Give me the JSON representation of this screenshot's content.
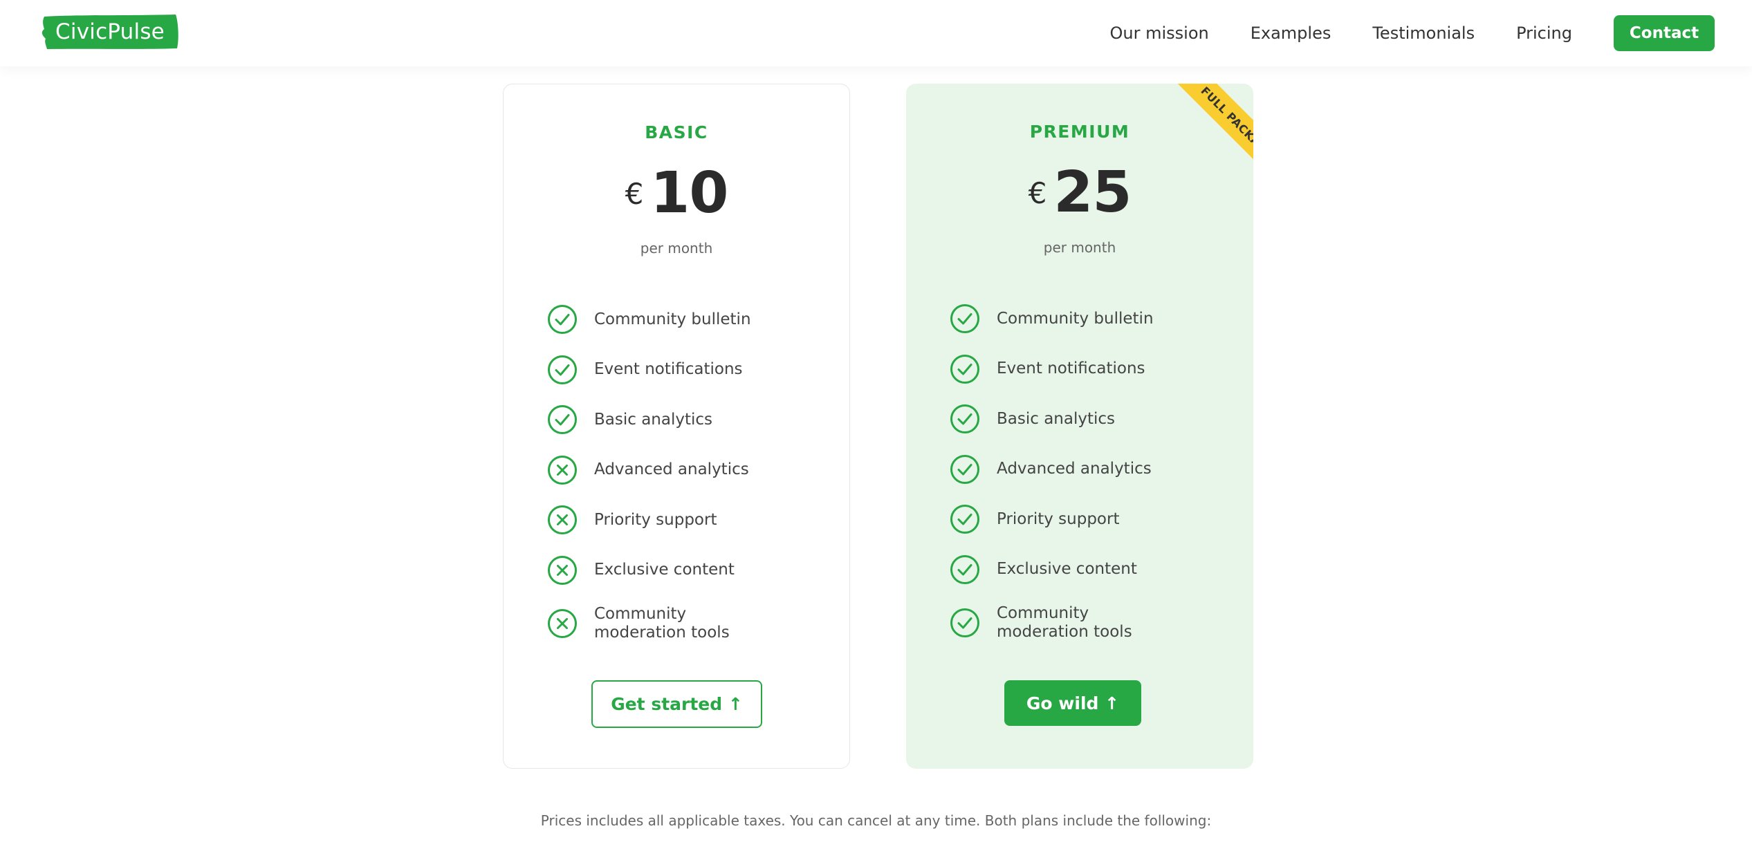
{
  "colors": {
    "accent": "#28a745",
    "ribbon": "#f9cc2f",
    "premium_bg": "#e8f5e9"
  },
  "header": {
    "logo_text": "CivicPulse",
    "nav": [
      {
        "label": "Our mission"
      },
      {
        "label": "Examples"
      },
      {
        "label": "Testimonials"
      },
      {
        "label": "Pricing"
      }
    ],
    "contact_label": "Contact"
  },
  "plans": [
    {
      "name": "BASIC",
      "currency": "€",
      "amount": "10",
      "period": "per month",
      "features": [
        {
          "label": "Community bulletin",
          "included": true
        },
        {
          "label": "Event notifications",
          "included": true
        },
        {
          "label": "Basic analytics",
          "included": true
        },
        {
          "label": "Advanced analytics",
          "included": false
        },
        {
          "label": "Priority support",
          "included": false
        },
        {
          "label": "Exclusive content",
          "included": false
        },
        {
          "label": "Community moderation tools",
          "included": false
        }
      ],
      "cta": "Get started ↑"
    },
    {
      "name": "PREMIUM",
      "currency": "€",
      "amount": "25",
      "period": "per month",
      "ribbon": "FULL PACKAGE",
      "features": [
        {
          "label": "Community bulletin",
          "included": true
        },
        {
          "label": "Event notifications",
          "included": true
        },
        {
          "label": "Basic analytics",
          "included": true
        },
        {
          "label": "Advanced analytics",
          "included": true
        },
        {
          "label": "Priority support",
          "included": true
        },
        {
          "label": "Exclusive content",
          "included": true
        },
        {
          "label": "Community moderation tools",
          "included": true
        }
      ],
      "cta": "Go wild ↑"
    }
  ],
  "footnote": "Prices includes all applicable taxes. You can cancel at any time. Both plans include the following:"
}
